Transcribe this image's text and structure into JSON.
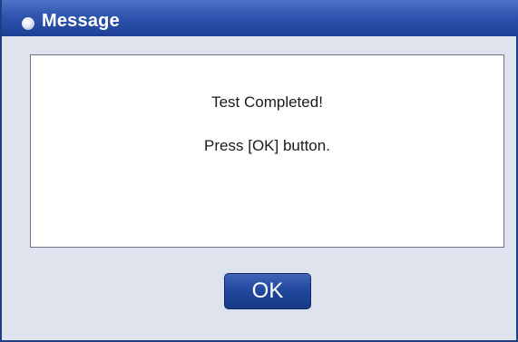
{
  "window": {
    "title": "Message"
  },
  "message": {
    "line1": "Test Completed!",
    "line2": "Press [OK] button."
  },
  "buttons": {
    "ok_label": "OK"
  },
  "colors": {
    "titlebar": "#2f55b0",
    "button": "#20479d",
    "panel": "#ffffff",
    "dialog_background": "#dfe3ee"
  }
}
